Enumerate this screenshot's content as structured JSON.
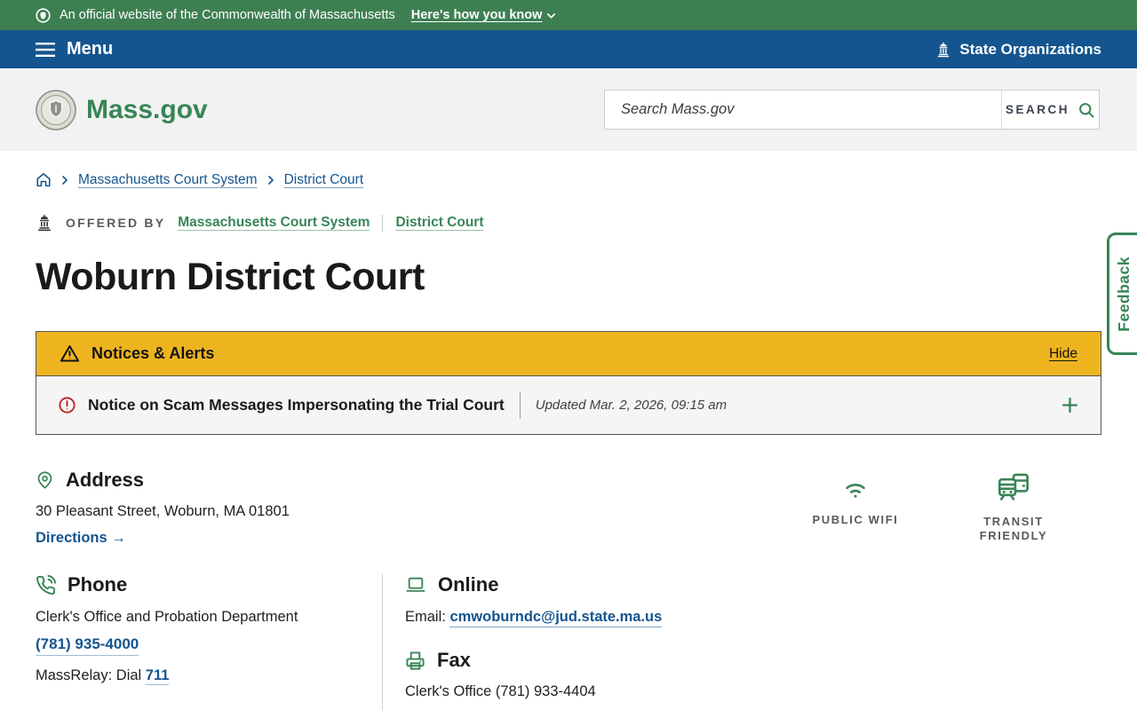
{
  "utility_bar": {
    "official_text": "An official website of the Commonwealth of Massachusetts",
    "how_you_know": "Here's how you know"
  },
  "menu_bar": {
    "menu_label": "Menu",
    "state_orgs_label": "State Organizations"
  },
  "header": {
    "logo_text": "Mass.gov",
    "search_placeholder": "Search Mass.gov",
    "search_button": "SEARCH"
  },
  "breadcrumb": {
    "items": [
      {
        "label": "Massachusetts Court System"
      },
      {
        "label": "District Court"
      }
    ]
  },
  "offered_by": {
    "label": "OFFERED BY",
    "links": [
      {
        "label": "Massachusetts Court System"
      },
      {
        "label": "District Court"
      }
    ]
  },
  "page": {
    "title": "Woburn District Court"
  },
  "alerts": {
    "banner_title": "Notices & Alerts",
    "hide_label": "Hide",
    "notice_title": "Notice on Scam Messages Impersonating the Trial Court",
    "notice_updated": "Updated Mar. 2, 2026, 09:15 am"
  },
  "address": {
    "heading": "Address",
    "line": "30 Pleasant Street, Woburn, MA 01801",
    "directions_label": "Directions →",
    "badges": [
      {
        "label": "PUBLIC WIFI"
      },
      {
        "label": "TRANSIT FRIENDLY"
      }
    ]
  },
  "phone": {
    "heading": "Phone",
    "department": "Clerk's Office and Probation Department",
    "number": "(781) 935-4000",
    "massrelay_prefix": "MassRelay: Dial ",
    "massrelay_number": "711"
  },
  "online": {
    "heading": "Online",
    "email_label": "Email: ",
    "email": "cmwoburndc@jud.state.ma.us"
  },
  "fax": {
    "heading": "Fax",
    "line": "Clerk's Office (781) 933-4404"
  },
  "feedback": {
    "label": "Feedback"
  },
  "colors": {
    "brand_green": "#388557",
    "utility_green": "#3e7f52",
    "menu_blue": "#14558f",
    "alert_yellow": "#eeb420",
    "alert_red": "#c3262c"
  }
}
